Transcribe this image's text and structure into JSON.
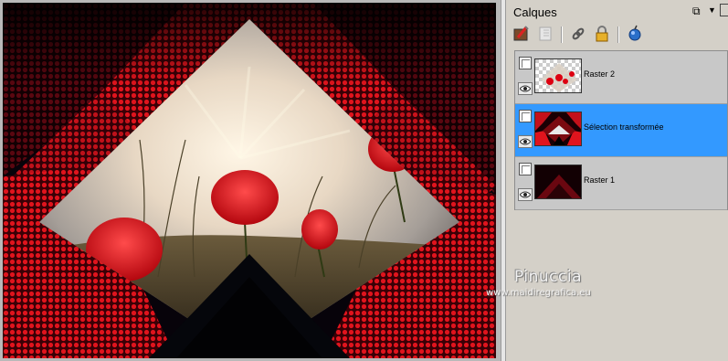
{
  "panel": {
    "title": "Calques",
    "menu_icon": "window-menu-icon",
    "dropdown_icon": "chevron-down-icon"
  },
  "toolbar": {
    "tools": [
      "new-raster-layer-icon",
      "layer-properties-icon",
      "link-layers-icon",
      "lock-transparency-icon",
      "merge-layers-icon"
    ]
  },
  "layers": [
    {
      "name": "Raster 2",
      "selected": false,
      "visible": true
    },
    {
      "name": "Sélection transformée",
      "selected": true,
      "visible": true
    },
    {
      "name": "Raster 1",
      "selected": false,
      "visible": true
    }
  ],
  "watermark": {
    "name": "Pinuccia",
    "url": "www.maidiregrafica.eu"
  },
  "colors": {
    "selection": "#3399ff",
    "accent_red": "#c4111a"
  }
}
